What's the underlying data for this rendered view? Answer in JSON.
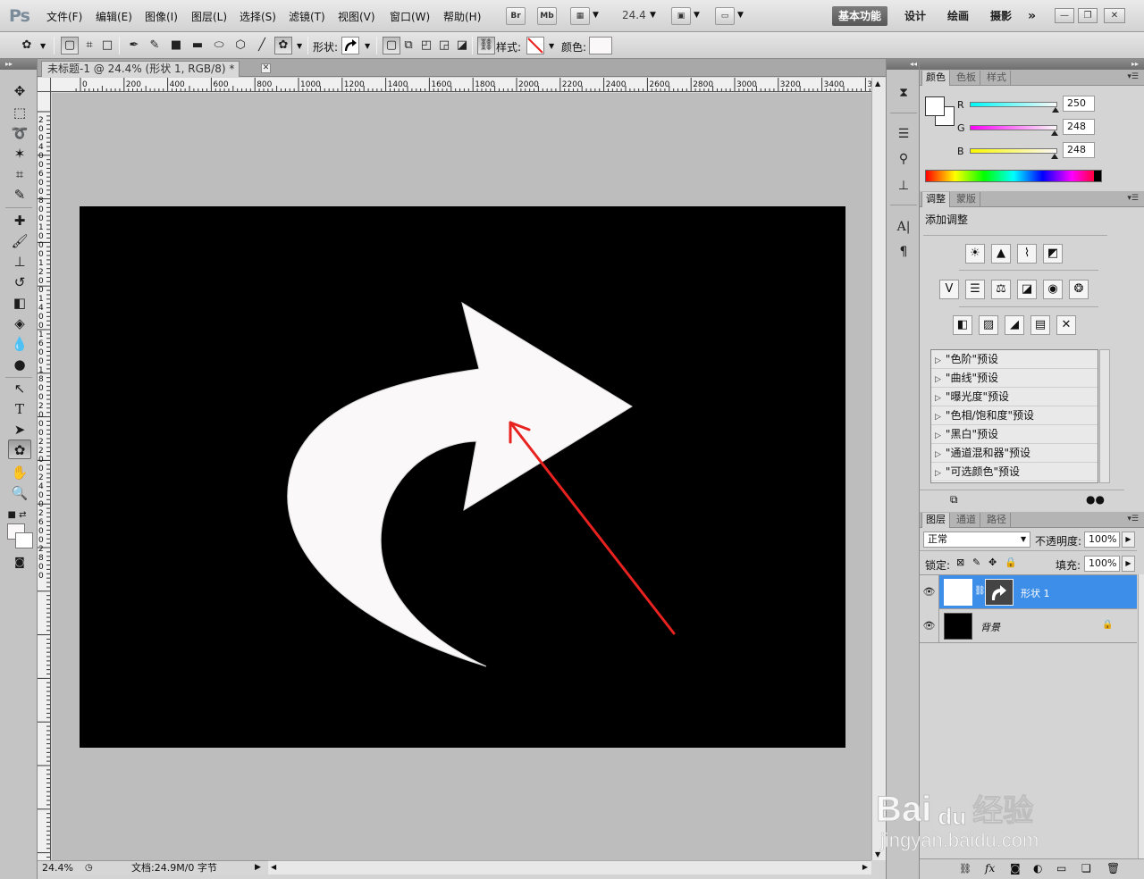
{
  "app": {
    "logo": "Ps",
    "menus": [
      "文件(F)",
      "编辑(E)",
      "图像(I)",
      "图层(L)",
      "选择(S)",
      "滤镜(T)",
      "视图(V)",
      "窗口(W)",
      "帮助(H)"
    ],
    "bridge_label": "Br",
    "minibridge_label": "Mb",
    "zoom_value": "24.4",
    "workspaces": {
      "basic": "基本功能",
      "design": "设计",
      "paint": "绘画",
      "photo": "摄影",
      "more": "»"
    },
    "window_buttons": {
      "minimize": "—",
      "restore": "❐",
      "close": "✕"
    }
  },
  "options": {
    "shape_label": "形状:",
    "style_label": "样式:",
    "color_label": "颜色:"
  },
  "document": {
    "tab_title": "未标题-1 @ 24.4% (形状 1, RGB/8) *",
    "tab_close": "✕",
    "ruler_top_labels": [
      "0",
      "200",
      "400",
      "600",
      "800",
      "1000",
      "1200",
      "1400",
      "1600",
      "1800",
      "2000",
      "2200",
      "2400",
      "2600",
      "2800",
      "3000",
      "3200",
      "3400",
      "3"
    ],
    "ruler_left_labels": [
      "2",
      "0",
      "0",
      "4",
      "0",
      "0",
      "6",
      "0",
      "0",
      "8",
      "0",
      "0",
      "1",
      "0",
      "0",
      "0",
      "1",
      "2",
      "0",
      "0",
      "1",
      "4",
      "0",
      "0",
      "1",
      "6",
      "0",
      "0",
      "1",
      "8",
      "0",
      "0",
      "2",
      "0",
      "0",
      "0",
      "2",
      "2",
      "0",
      "0",
      "2",
      "4",
      "0",
      "0",
      "2",
      "6",
      "0",
      "0",
      "2",
      "8",
      "0",
      "0"
    ],
    "status_zoom": "24.4%",
    "status_doc": "文档:24.9M/0 字节"
  },
  "colors": {
    "accent_red": "#e8221e",
    "canvas_bg": "#000000",
    "shape_fill": "#faf8f8",
    "layer_selected": "#3d8ee8"
  },
  "color_panel": {
    "tabs": [
      "颜色",
      "色板",
      "样式"
    ],
    "r_label": "R",
    "r_value": "250",
    "g_label": "G",
    "g_value": "248",
    "b_label": "B",
    "b_value": "248"
  },
  "adjust_panel": {
    "tabs": [
      "调整",
      "蒙版"
    ],
    "title": "添加调整",
    "presets": [
      "\"色阶\"预设",
      "\"曲线\"预设",
      "\"曝光度\"预设",
      "\"色相/饱和度\"预设",
      "\"黑白\"预设",
      "\"通道混和器\"预设",
      "\"可选颜色\"预设"
    ]
  },
  "layers_panel": {
    "tabs": [
      "图层",
      "通道",
      "路径"
    ],
    "blend_mode": "正常",
    "opacity_label": "不透明度:",
    "opacity_value": "100%",
    "lock_label": "锁定:",
    "fill_label": "填充:",
    "fill_value": "100%",
    "layers": [
      {
        "name": "形状 1",
        "selected": true
      },
      {
        "name": "背景",
        "selected": false
      }
    ],
    "fx_label": "fx"
  },
  "watermark": {
    "brand": "Bai",
    "brand2": "du",
    "cn": "经验",
    "url": "jingyan.baidu.com"
  }
}
